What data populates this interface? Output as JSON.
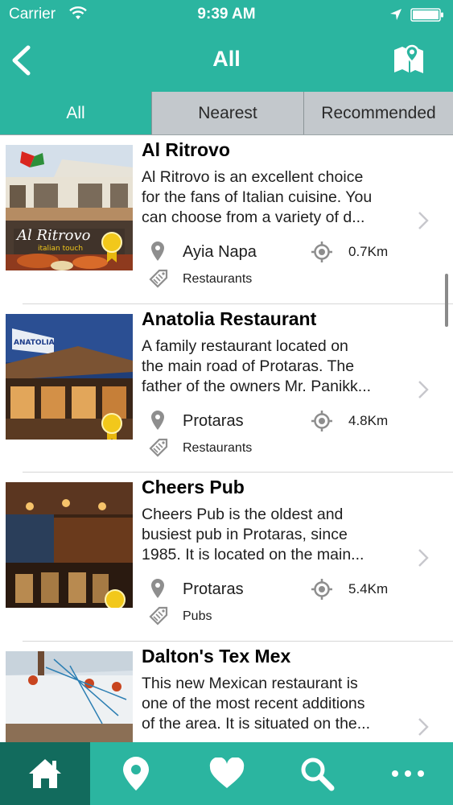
{
  "status_bar": {
    "carrier": "Carrier",
    "time": "9:39 AM"
  },
  "nav": {
    "title": "All",
    "back_icon": "chevron-left-icon",
    "map_icon": "map-pin-icon"
  },
  "tabs": [
    {
      "label": "All",
      "active": true
    },
    {
      "label": "Nearest",
      "active": false
    },
    {
      "label": "Recommended",
      "active": false
    }
  ],
  "items": [
    {
      "name": "Al Ritrovo",
      "desc_lines": [
        "Al Ritrovo is an excellent choice",
        "for the fans of Italian cuisine. You",
        "can choose from a variety of d..."
      ],
      "town": "Ayia Napa",
      "distance": "0.7Km",
      "category": "Restaurants",
      "recommended": true,
      "thumb_text": [
        "Al Ritrovo",
        "italian touch"
      ]
    },
    {
      "name": "Anatolia Restaurant",
      "desc_lines": [
        "A family restaurant located on",
        "the main road of Protaras. The",
        "father of the owners Mr. Panikk..."
      ],
      "town": "Protaras",
      "distance": "4.8Km",
      "category": "Restaurants",
      "recommended": true,
      "thumb_text": [
        "ANATOLIA"
      ]
    },
    {
      "name": "Cheers Pub",
      "desc_lines": [
        "Cheers Pub is the oldest and",
        "busiest pub in Protaras, since",
        "1985. It is located on the main..."
      ],
      "town": "Protaras",
      "distance": "5.4Km",
      "category": "Pubs",
      "recommended": true,
      "thumb_text": []
    },
    {
      "name": "Dalton's Tex Mex",
      "desc_lines": [
        "This new Mexican restaurant is",
        "one of the most recent additions",
        "of the area. It is situated on the..."
      ],
      "town": "",
      "distance": "",
      "category": "",
      "recommended": false,
      "thumb_text": []
    }
  ],
  "tab_bar": [
    {
      "icon": "home-icon",
      "active": true
    },
    {
      "icon": "location-pin-icon",
      "active": false
    },
    {
      "icon": "heart-icon",
      "active": false
    },
    {
      "icon": "search-icon",
      "active": false
    },
    {
      "icon": "more-icon",
      "active": false
    }
  ],
  "colors": {
    "brand": "#2bb5a0",
    "brand_dark": "#126b5d",
    "tab_inactive": "#c3c8cc",
    "ribbon": "#f2c81b"
  }
}
